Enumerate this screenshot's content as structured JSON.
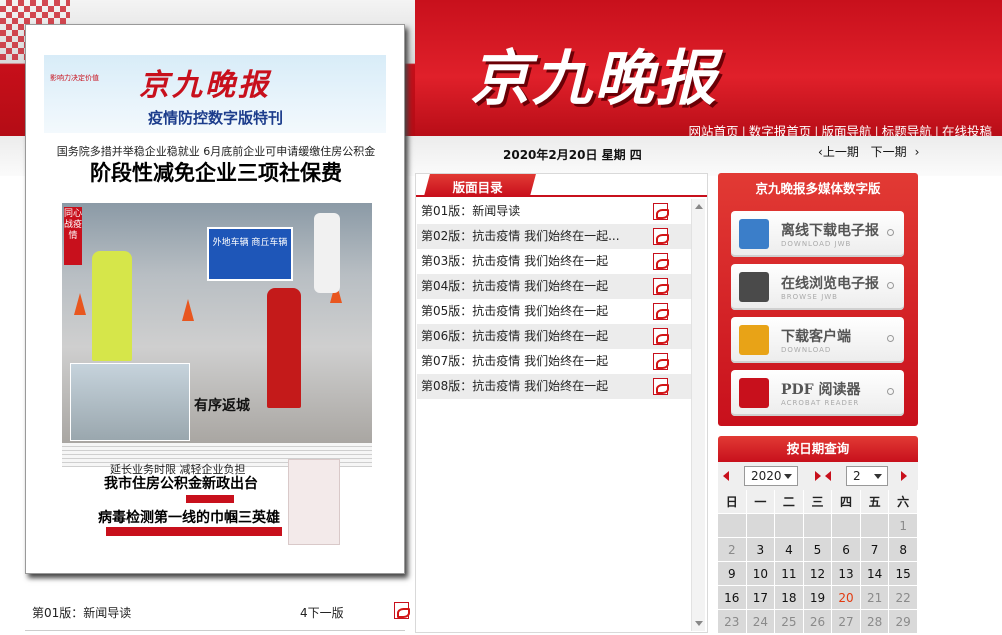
{
  "header": {
    "masthead": "京九晚报",
    "nav": [
      "网站首页",
      "数字报首页",
      "版面导航",
      "标题导航",
      "在线投稿"
    ],
    "nav_sep": "|"
  },
  "datebar": {
    "date": "2020年2月20日 星期 四",
    "prev": "上一期",
    "next": "下一期"
  },
  "paper": {
    "masthead": "京九晚报",
    "subtitle": "疫情防控数字版特刊",
    "side_note": "影响力决定价值",
    "kicker": "国务院多措并举稳企业稳就业 6月底前企业可申请缓缴住房公积金",
    "headline": "阶段性减免企业三项社保费",
    "photo_sign": "外地车辆  商丘车辆",
    "photo_tag": "同心战疫情",
    "photo_caption": "有序返城",
    "story2_kicker": "延长业务时限 减轻企业负担",
    "story2": "我市住房公积金新政出台",
    "story3": "病毒检测第一线的巾帼三英雄",
    "footer_page": "第01版：新闻导读",
    "footer_next": "4下一版"
  },
  "directory": {
    "title": "版面目录",
    "rows": [
      "第01版：新闻导读",
      "第02版：抗击疫情 我们始终在一起...",
      "第03版：抗击疫情 我们始终在一起",
      "第04版：抗击疫情 我们始终在一起",
      "第05版：抗击疫情 我们始终在一起",
      "第06版：抗击疫情 我们始终在一起",
      "第07版：抗击疫情 我们始终在一起",
      "第08版：抗击疫情 我们始终在一起"
    ]
  },
  "media": {
    "title": "京九晚报多媒体数字版",
    "buttons": [
      {
        "label": "离线下载电子报",
        "sub": "DOWNLOAD JWB",
        "icon": "books-icon",
        "color": "#3b7ec9"
      },
      {
        "label": "在线浏览电子报",
        "sub": "BROWSE JWB",
        "icon": "monitor-icon",
        "color": "#4a4a4a"
      },
      {
        "label": "下载客户端",
        "sub": "DOWNLOAD",
        "icon": "folder-icon",
        "color": "#e8a317"
      },
      {
        "label": "PDF 阅读器",
        "sub": "ACROBAT READER",
        "icon": "acrobat-icon",
        "color": "#c8101c"
      }
    ]
  },
  "calendar": {
    "title": "按日期查询",
    "year": "2020",
    "month": "2",
    "weekdays": [
      "日",
      "一",
      "二",
      "三",
      "四",
      "五",
      "六"
    ],
    "weeks": [
      [
        "",
        "",
        "",
        "",
        "",
        "",
        "1"
      ],
      [
        "2",
        "3",
        "4",
        "5",
        "6",
        "7",
        "8"
      ],
      [
        "9",
        "10",
        "11",
        "12",
        "13",
        "14",
        "15"
      ],
      [
        "16",
        "17",
        "18",
        "19",
        "20",
        "21",
        "22"
      ],
      [
        "23",
        "24",
        "25",
        "26",
        "27",
        "28",
        "29"
      ]
    ],
    "today": "20"
  }
}
